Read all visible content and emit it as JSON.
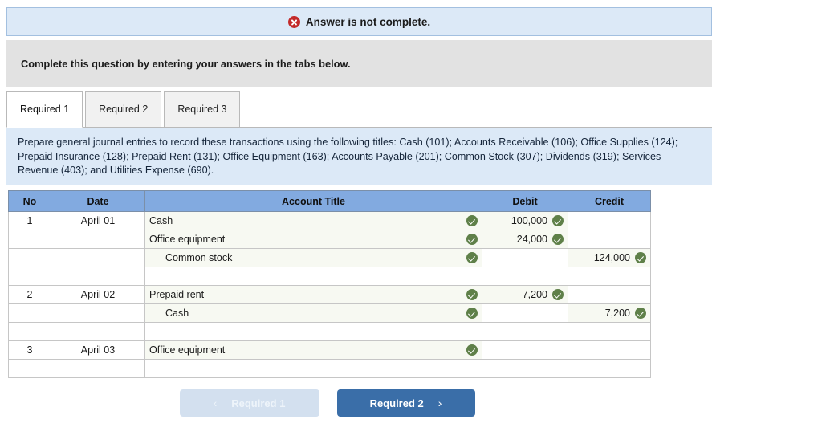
{
  "alert": {
    "icon": "error-circle-icon",
    "text": "Answer is not complete."
  },
  "instruction_strip": {
    "text": "Complete this question by entering your answers in the tabs below."
  },
  "tabs": [
    {
      "label": "Required 1",
      "active": true
    },
    {
      "label": "Required 2",
      "active": false
    },
    {
      "label": "Required 3",
      "active": false
    }
  ],
  "instruction_panel": {
    "text": "Prepare general journal entries to record these transactions using the following titles: Cash (101); Accounts Receivable (106); Office Supplies (124); Prepaid Insurance (128); Prepaid Rent (131); Office Equipment (163); Accounts Payable (201); Common Stock (307); Dividends (319); Services Revenue (403); and Utilities Expense (690)."
  },
  "journal": {
    "headers": {
      "no": "No",
      "date": "Date",
      "account_title": "Account Title",
      "debit": "Debit",
      "credit": "Credit"
    },
    "rows": [
      {
        "no": "1",
        "date": "April 01",
        "account": "Cash",
        "indent": false,
        "account_ok": true,
        "debit": "100,000",
        "debit_ok": true,
        "credit": "",
        "credit_ok": false,
        "filled": true,
        "sep": false
      },
      {
        "no": "",
        "date": "",
        "account": "Office equipment",
        "indent": false,
        "account_ok": true,
        "debit": "24,000",
        "debit_ok": true,
        "credit": "",
        "credit_ok": false,
        "filled": true,
        "sep": false
      },
      {
        "no": "",
        "date": "",
        "account": "Common stock",
        "indent": true,
        "account_ok": true,
        "debit": "",
        "debit_ok": false,
        "credit": "124,000",
        "credit_ok": true,
        "filled": true,
        "sep": false
      },
      {
        "no": "",
        "date": "",
        "account": "",
        "indent": false,
        "account_ok": false,
        "debit": "",
        "debit_ok": false,
        "credit": "",
        "credit_ok": false,
        "filled": false,
        "sep": false
      },
      {
        "no": "2",
        "date": "April 02",
        "account": "Prepaid rent",
        "indent": false,
        "account_ok": true,
        "debit": "7,200",
        "debit_ok": true,
        "credit": "",
        "credit_ok": false,
        "filled": true,
        "sep": true
      },
      {
        "no": "",
        "date": "",
        "account": "Cash",
        "indent": true,
        "account_ok": true,
        "debit": "",
        "debit_ok": false,
        "credit": "7,200",
        "credit_ok": true,
        "filled": true,
        "sep": false
      },
      {
        "no": "",
        "date": "",
        "account": "",
        "indent": false,
        "account_ok": false,
        "debit": "",
        "debit_ok": false,
        "credit": "",
        "credit_ok": false,
        "filled": false,
        "sep": false
      },
      {
        "no": "3",
        "date": "April 03",
        "account": "Office equipment",
        "indent": false,
        "account_ok": true,
        "debit": "",
        "debit_ok": false,
        "credit": "",
        "credit_ok": false,
        "filled": true,
        "sep": true
      },
      {
        "no": "",
        "date": "",
        "account": "",
        "indent": false,
        "account_ok": false,
        "debit": "",
        "debit_ok": false,
        "credit": "",
        "credit_ok": false,
        "filled": false,
        "sep": false
      }
    ]
  },
  "footer": {
    "prev": {
      "label": "Required 1",
      "chevron": "‹",
      "enabled": false
    },
    "next": {
      "label": "Required 2",
      "chevron": "›",
      "enabled": true
    }
  },
  "colors": {
    "alert_bg": "#dce9f7",
    "alert_border": "#a3c0e0",
    "error_red": "#c32a2a",
    "strip_bg": "#e2e2e2",
    "table_header_blue": "#82aae0",
    "check_green": "#5f8049",
    "filled_cell": "#f7f9f2",
    "next_button_blue": "#3a6ea8",
    "prev_button_blue": "#d3e0ef"
  }
}
